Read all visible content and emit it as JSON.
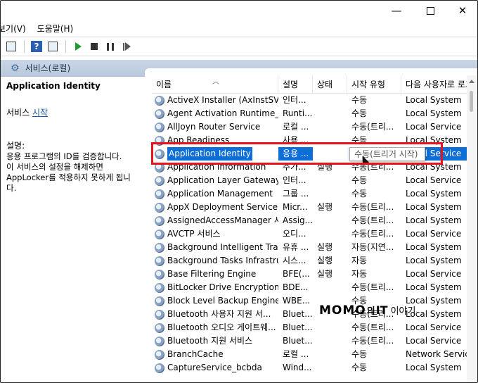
{
  "menu": [
    "보기(V)",
    "도움말(H)"
  ],
  "scope_header": "서비스(로컬)",
  "left_pane": {
    "service_title": "Application Identity",
    "service_prefix": "서비스",
    "start_link": "시작",
    "description_label": "설명:",
    "description": "응용 프로그램의 ID를 검증합니다.\n이 서비스의 설정을 해제하면\nAppLocker를 적용하지 못하게 됩니다."
  },
  "columns": {
    "name": "이름",
    "description": "설명",
    "status": "상태",
    "startup": "시작 유형",
    "logon": "다음 사용자로 로그온"
  },
  "services": [
    {
      "name": "ActiveX Installer (AxInstSV)",
      "desc": "인터...",
      "status": "",
      "startup": "수동",
      "logon": "Local System"
    },
    {
      "name": "Agent Activation Runtime_...",
      "desc": "Runti...",
      "status": "",
      "startup": "수동",
      "logon": "Local System"
    },
    {
      "name": "AllJoyn Router Service",
      "desc": "로컬 ...",
      "status": "",
      "startup": "수동(트리...",
      "logon": "Local Service"
    },
    {
      "name": "App Readiness",
      "desc": "사용 ...",
      "status": "",
      "startup": "수동",
      "logon": "Local System"
    },
    {
      "name": "Application Identity",
      "desc": "응용 ...",
      "status": "",
      "startup": "수동(트리...",
      "logon": "Local Service"
    },
    {
      "name": "Application Information",
      "desc": "추가...",
      "status": "실행",
      "startup": "수동(트리...",
      "logon": "Local System"
    },
    {
      "name": "Application Layer Gateway ...",
      "desc": "인터...",
      "status": "",
      "startup": "수동",
      "logon": "Local Service"
    },
    {
      "name": "Application Management",
      "desc": "그룹 ...",
      "status": "",
      "startup": "수동",
      "logon": "Local System"
    },
    {
      "name": "AppX Deployment Service (...",
      "desc": "Micr...",
      "status": "실행",
      "startup": "수동(트리...",
      "logon": "Local System"
    },
    {
      "name": "AssignedAccessManager 서...",
      "desc": "Assig...",
      "status": "",
      "startup": "수동(트리...",
      "logon": "Local System"
    },
    {
      "name": "AVCTP 서비스",
      "desc": "오디...",
      "status": "",
      "startup": "수동(트리...",
      "logon": "Local Service"
    },
    {
      "name": "Background Intelligent Tra...",
      "desc": "유휴 ...",
      "status": "실행",
      "startup": "자동(지연...",
      "logon": "Local System"
    },
    {
      "name": "Background Tasks Infrastru...",
      "desc": "시스...",
      "status": "실행",
      "startup": "자동",
      "logon": "Local System"
    },
    {
      "name": "Base Filtering Engine",
      "desc": "BFE(...",
      "status": "실행",
      "startup": "자동",
      "logon": "Local Service"
    },
    {
      "name": "BitLocker Drive Encryption ...",
      "desc": "BDE...",
      "status": "",
      "startup": "수동(트리...",
      "logon": "Local System"
    },
    {
      "name": "Block Level Backup Engine ...",
      "desc": "WBE...",
      "status": "",
      "startup": "수동",
      "logon": "Local System"
    },
    {
      "name": "Bluetooth 사용자 지원 서...",
      "desc": "Bluet...",
      "status": "",
      "startup": "수동(트리...",
      "logon": "Local System"
    },
    {
      "name": "Bluetooth 오디오 게이트웨...",
      "desc": "Bluet...",
      "status": "",
      "startup": "수동(트리...",
      "logon": "Local Service"
    },
    {
      "name": "Bluetooth 지원 서비스",
      "desc": "Bluet...",
      "status": "",
      "startup": "수동(트리...",
      "logon": "Local Service"
    },
    {
      "name": "BranchCache",
      "desc": "로컬 ...",
      "status": "",
      "startup": "수동",
      "logon": "Network Service"
    },
    {
      "name": "CaptureService_bcbda",
      "desc": "Wind...",
      "status": "",
      "startup": "수동",
      "logon": "Local System"
    }
  ],
  "tooltip": "수동(트리거 시작)",
  "watermark": {
    "a": "MOMO",
    "b": "의",
    "c": "IT",
    "d": "이야기"
  },
  "colors": {
    "selection": "#0c6ed6",
    "highlight_box": "#e8141c",
    "link": "#1c5aa6"
  }
}
